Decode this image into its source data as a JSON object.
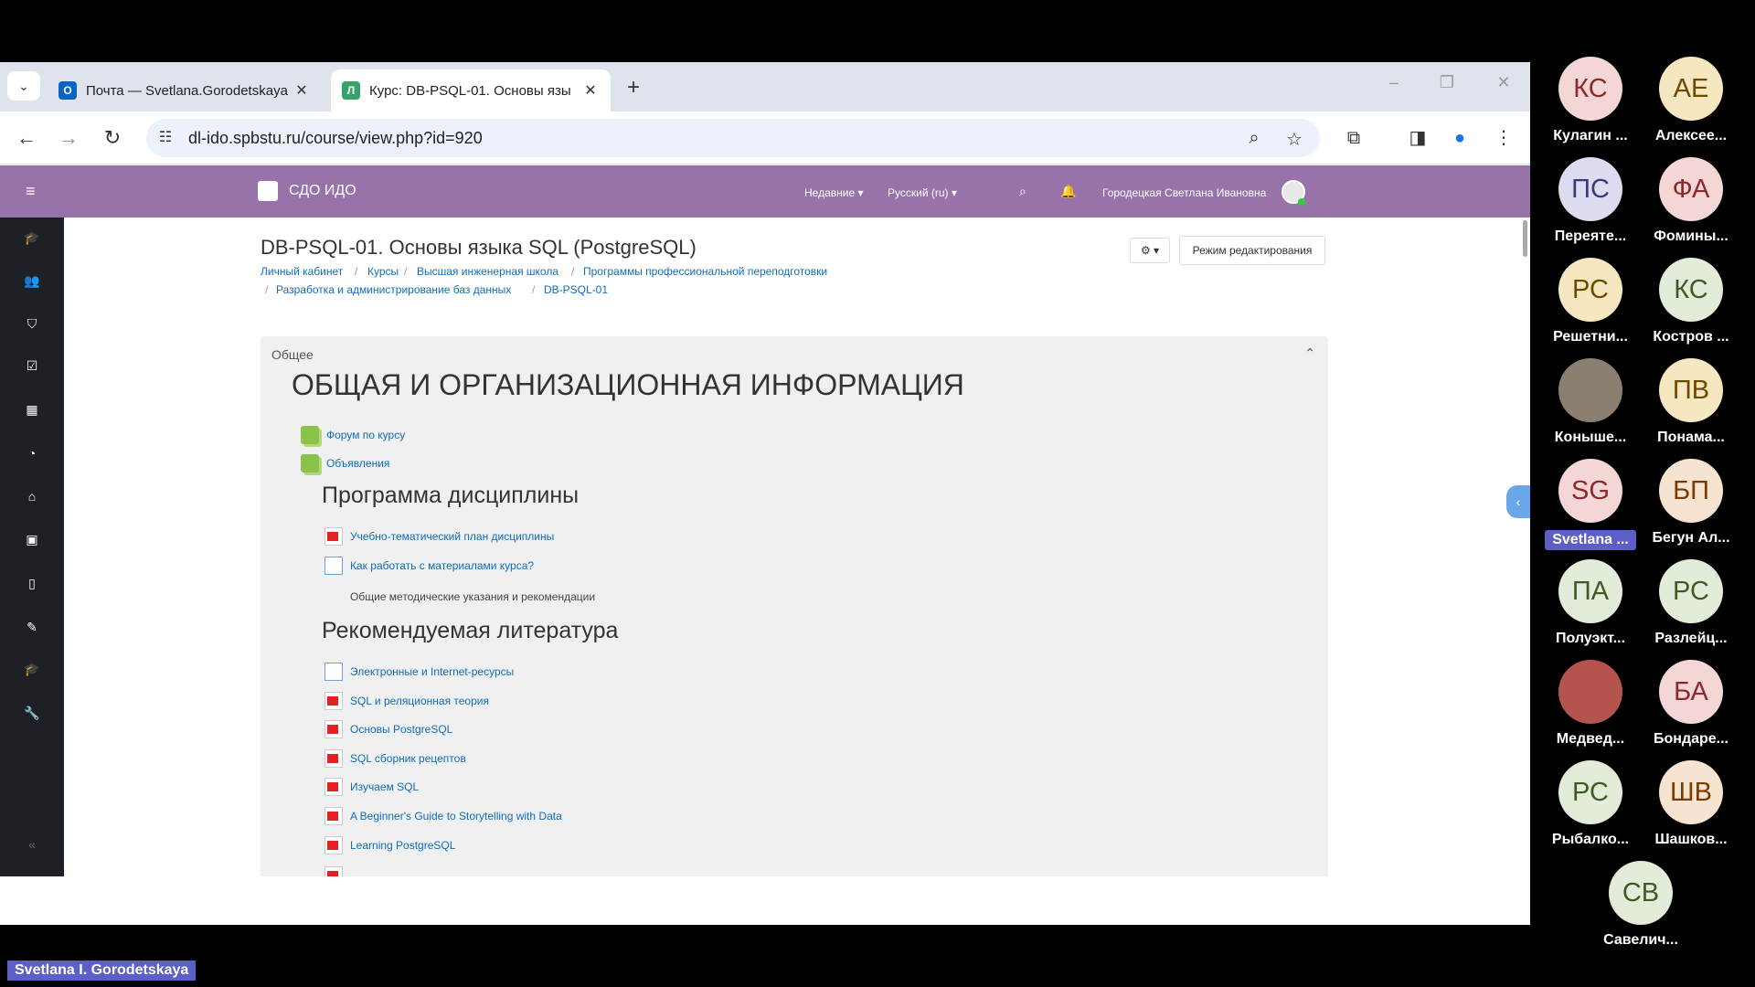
{
  "browser": {
    "tabs": [
      {
        "title": "Почта — Svetlana.Gorodetskaya",
        "active": false
      },
      {
        "title": "Курс: DB-PSQL-01. Основы язы",
        "active": true
      }
    ],
    "new_tab": "+",
    "url": "dl-ido.spbstu.ru/course/view.php?id=920"
  },
  "moodle": {
    "site_name": "СДО ИДО",
    "nav_recent": "Недавние ▾",
    "nav_lang": "Русский (ru) ▾",
    "user_name": "Городецкая Светлана Ивановна",
    "course_title": "DB-PSQL-01. Основы языка SQL (PostgreSQL)",
    "breadcrumb": [
      "Личный кабинет",
      "Курсы",
      "Высшая инженерная школа",
      "Программы профессиональной переподготовки",
      "Разработка и администрирование баз данных",
      "DB-PSQL-01"
    ],
    "gear_label": "⚙ ▾",
    "edit_mode": "Режим редактирования",
    "section_label": "Общее",
    "section_heading": "ОБЩАЯ И ОРГАНИЗАЦИОННАЯ ИНФОРМАЦИЯ",
    "forum_links": [
      "Форум по курсу",
      "Объявления"
    ],
    "program_heading": "Программа дисциплины",
    "program_items": [
      "Учебно-тематический план дисциплины",
      "Как работать с материалами курса?"
    ],
    "program_text": "Общие методические указания и рекомендации",
    "literature_heading": "Рекомендуемая литература",
    "literature_items": [
      "Электронные и Internet-ресурсы",
      "SQL и реляционная теория",
      "Основы PostgreSQL",
      "SQL сборник рецептов",
      "Изучаем SQL",
      "A Beginner's Guide to Storytelling with Data",
      "Learning PostgreSQL"
    ]
  },
  "participants": [
    {
      "initials": "КС",
      "name": "Кулагин ...",
      "bg": "#f4d6d6",
      "fg": "#8a2a2a"
    },
    {
      "initials": "АЕ",
      "name": "Алексее...",
      "bg": "#f6e7c0",
      "fg": "#6b4a00"
    },
    {
      "initials": "ПС",
      "name": "Переяте...",
      "bg": "#dcdcf0",
      "fg": "#3a3a7a"
    },
    {
      "initials": "ФА",
      "name": "Фомины...",
      "bg": "#f4d6d6",
      "fg": "#8a2a2a"
    },
    {
      "initials": "РС",
      "name": "Решетни...",
      "bg": "#f6e7c0",
      "fg": "#6b4a00"
    },
    {
      "initials": "КС",
      "name": "Костров ...",
      "bg": "#e2ecd8",
      "fg": "#3f5a26"
    },
    {
      "initials": "",
      "name": "Коныше...",
      "bg": "#8a7f70",
      "fg": "#fff"
    },
    {
      "initials": "ПВ",
      "name": "Понама...",
      "bg": "#f6e7c0",
      "fg": "#6b4a00"
    },
    {
      "initials": "SG",
      "name": "Svetlana ...",
      "bg": "#f4d6d6",
      "fg": "#8a2a2a"
    },
    {
      "initials": "БП",
      "name": "Бегун Ал...",
      "bg": "#f6e3d0",
      "fg": "#7a3b00"
    },
    {
      "initials": "ПА",
      "name": "Полуэкт...",
      "bg": "#e2ecd8",
      "fg": "#3f5a26"
    },
    {
      "initials": "РС",
      "name": "Разлейц...",
      "bg": "#e2ecd8",
      "fg": "#3f5a26"
    },
    {
      "initials": "",
      "name": "Медвед...",
      "bg": "#b5544e",
      "fg": "#fff"
    },
    {
      "initials": "БА",
      "name": "Бондаре...",
      "bg": "#f4d6d6",
      "fg": "#8a2a2a"
    },
    {
      "initials": "РС",
      "name": "Рыбалко...",
      "bg": "#e2ecd8",
      "fg": "#3f5a26"
    },
    {
      "initials": "ШВ",
      "name": "Шашков...",
      "bg": "#f6e3d0",
      "fg": "#7a3b00"
    },
    {
      "initials": "СВ",
      "name": "Савелич...",
      "bg": "#e2ecd8",
      "fg": "#3f5a26"
    }
  ],
  "active_speaker": "Svetlana I. Gorodetskaya"
}
